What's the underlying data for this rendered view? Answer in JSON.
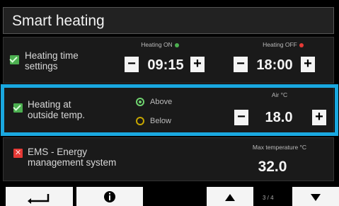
{
  "title": "Smart heating",
  "rows": [
    {
      "label_line1": "Heating time",
      "label_line2": "settings",
      "checkbox": "checked",
      "on": {
        "caption": "Heating ON",
        "value": "09:15",
        "status_color": "#4caf50"
      },
      "off": {
        "caption": "Heating OFF",
        "value": "18:00",
        "status_color": "#e53935"
      },
      "minus": "−",
      "plus": "+"
    },
    {
      "label_line1": "Heating at",
      "label_line2": "outside temp.",
      "checkbox": "checked",
      "options": [
        "Above",
        "Below"
      ],
      "selected": "Above",
      "caption": "Air °C",
      "value": "18.0",
      "minus": "−",
      "plus": "+"
    },
    {
      "label_line1": "EMS - Energy",
      "label_line2": "management system",
      "checkbox": "unchecked",
      "caption": "Max temperature °C",
      "value": "32.0"
    }
  ],
  "bottom": {
    "back_icon": "return-arrow-icon",
    "info_icon": "info-icon",
    "up_icon": "triangle-up-icon",
    "down_icon": "triangle-down-icon",
    "page": "3 / 4"
  },
  "colors": {
    "highlight": "#1aa8e0",
    "check_on": "#4caf50",
    "check_off": "#e53935"
  }
}
